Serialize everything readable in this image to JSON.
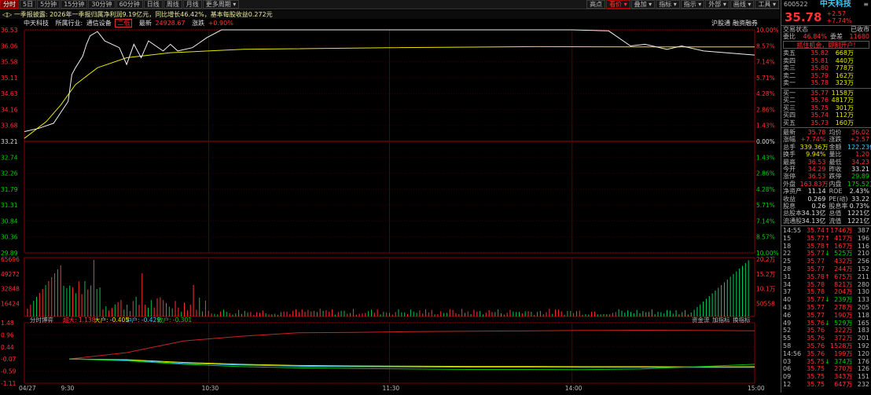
{
  "toolbar": {
    "left": [
      "分时",
      "5日",
      "5分钟",
      "15分钟",
      "30分钟",
      "60分钟",
      "日线",
      "周线",
      "月线",
      "更多周期"
    ],
    "right": [
      "高点",
      "看价",
      "叠加",
      "指标",
      "指示",
      "外部",
      "画线",
      "工具"
    ]
  },
  "info_bar": {
    "collapse": "◁▷",
    "text": "一季报披露: 2026年一季报归属净利润9.19亿元，同比增长46.42%，基本每股收益0.272元"
  },
  "stock_bar": {
    "name": "中天科技",
    "industry_label": "所属行业:",
    "industry": "通信设备",
    "tag": "二低",
    "latest_label": "最新",
    "latest": "24928.67",
    "change_label": "涨跌",
    "change": "+0.90%",
    "right1": "沪股通",
    "right2": "融资融券"
  },
  "chart_data": {
    "type": "line",
    "price_axis": [
      "36.53",
      "36.06",
      "35.58",
      "35.11",
      "34.63",
      "34.16",
      "33.68",
      "33.21",
      "32.74",
      "32.26",
      "31.79",
      "31.31",
      "30.84",
      "30.36",
      "29.89"
    ],
    "pct_axis": [
      "10.00%",
      "8.57%",
      "7.14%",
      "5.71%",
      "4.28%",
      "2.86%",
      "1.43%",
      "0.00%",
      "1.43%",
      "2.86%",
      "4.28%",
      "5.71%",
      "7.14%",
      "8.57%",
      "10.00%"
    ],
    "pre_close": 33.21,
    "ylim": [
      29.89,
      36.53
    ],
    "price_series": {
      "name": "价格",
      "t": [
        0,
        0.02,
        0.04,
        0.06,
        0.065,
        0.07,
        0.08,
        0.085,
        0.09,
        0.1,
        0.11,
        0.13,
        0.14,
        0.15,
        0.16,
        0.17,
        0.19,
        0.2,
        0.21,
        0.23,
        0.25,
        0.27,
        0.3,
        0.35,
        0.45,
        0.55,
        0.65,
        0.75,
        0.8,
        0.83,
        0.85,
        0.88,
        0.9,
        0.93,
        0.96,
        1.0
      ],
      "v": [
        33.5,
        33.6,
        33.75,
        34.4,
        35.2,
        35.4,
        35.75,
        36.1,
        36.35,
        36.48,
        36.2,
        36.0,
        35.5,
        36.1,
        35.7,
        36.2,
        35.9,
        36.1,
        35.9,
        36.0,
        36.3,
        36.53,
        36.53,
        36.53,
        36.53,
        36.53,
        36.53,
        36.53,
        36.5,
        36.05,
        36.1,
        35.95,
        36.05,
        35.9,
        35.85,
        35.78
      ]
    },
    "avg_series": {
      "name": "均价",
      "t": [
        0,
        0.03,
        0.05,
        0.07,
        0.1,
        0.14,
        0.2,
        0.3,
        0.5,
        0.7,
        0.85,
        1.0
      ],
      "v": [
        33.3,
        33.8,
        34.3,
        34.9,
        35.4,
        35.7,
        35.85,
        35.95,
        36.0,
        36.03,
        36.02,
        36.02
      ]
    },
    "volume_axis": [
      "65696",
      "49272",
      "32848",
      "16424"
    ],
    "volume_axis_right": [
      "20.2万",
      "15.2万",
      "10.1万",
      "50558"
    ],
    "indicator_title": "分时博弈",
    "indicator_legend": [
      "超大: 1.138",
      "大户: -0.405",
      "中户: -0.429",
      "散户: -0.301"
    ],
    "indicator_axis": [
      "1.48",
      "0.96",
      "0.44",
      "-0.07",
      "-0.59",
      "-1.11"
    ],
    "indicator_right": [
      "资金流",
      "加指标",
      "换指标"
    ],
    "time_axis": [
      "04/27",
      "9:30",
      "10:30",
      "11:30",
      "14:00",
      "15:00"
    ]
  },
  "panel": {
    "code": "600522",
    "name": "中天科技",
    "price": "35.78",
    "chg": "+2.57",
    "chg_pct": "+7.74%",
    "tabs": [
      "交易状态",
      "已收市"
    ],
    "ratio": {
      "k1": "委比",
      "v1": "46.84%",
      "k2": "委差",
      "v2": "11680"
    },
    "opportunity": "抓住机会，即刻开户!",
    "asks": [
      {
        "label": "卖五",
        "price": "35.82",
        "vol": "668万"
      },
      {
        "label": "卖四",
        "price": "35.81",
        "vol": "440万"
      },
      {
        "label": "卖三",
        "price": "35.80",
        "vol": "778万"
      },
      {
        "label": "卖二",
        "price": "35.79",
        "vol": "162万"
      },
      {
        "label": "卖一",
        "price": "35.78",
        "vol": "323万"
      }
    ],
    "bids": [
      {
        "label": "买一",
        "price": "35.77",
        "vol": "1158万"
      },
      {
        "label": "买二",
        "price": "35.76",
        "vol": "4817万"
      },
      {
        "label": "买三",
        "price": "35.75",
        "vol": "301万"
      },
      {
        "label": "买四",
        "price": "35.74",
        "vol": "112万"
      },
      {
        "label": "买五",
        "price": "35.73",
        "vol": "160万"
      }
    ],
    "stats": [
      {
        "k": "最新",
        "v": "35.78",
        "c": "red",
        "k2": "均价",
        "v2": "36.02",
        "c2": "red"
      },
      {
        "k": "涨幅",
        "v": "+7.74%",
        "c": "red",
        "k2": "涨跌",
        "v2": "+2.57",
        "c2": "red"
      },
      {
        "k": "总手",
        "v": "339.36万",
        "c": "yellow",
        "k2": "金额",
        "v2": "122.23亿",
        "c2": "cyan"
      },
      {
        "k": "换手",
        "v": "9.94%",
        "c": "yellow",
        "k2": "量比",
        "v2": "1.20",
        "c2": "red"
      },
      {
        "k": "最高",
        "v": "36.53",
        "c": "red",
        "k2": "最低",
        "v2": "34.23",
        "c2": "red"
      },
      {
        "k": "今开",
        "v": "34.29",
        "c": "red",
        "k2": "昨收",
        "v2": "33.21",
        "c2": "white"
      },
      {
        "k": "涨停",
        "v": "36.53",
        "c": "red",
        "k2": "跌停",
        "v2": "29.89",
        "c2": "green"
      },
      {
        "k": "外盘",
        "v": "163.83万",
        "c": "red",
        "k2": "内盘",
        "v2": "175.52万",
        "c2": "green"
      },
      {
        "k": "净资产",
        "v": "11.14",
        "c": "white",
        "k2": "ROE",
        "v2": "2.43%",
        "c2": "white"
      },
      {
        "k": "收益",
        "v": "0.269",
        "c": "white",
        "k2": "PE(动)",
        "v2": "33.22",
        "c2": "white"
      },
      {
        "k": "股息",
        "v": "0.26",
        "c": "white",
        "k2": "股息率",
        "v2": "0.73%",
        "c2": "white"
      },
      {
        "k": "总股本",
        "v": "34.13亿",
        "c": "white",
        "k2": "总值",
        "v2": "1221亿",
        "c2": "white"
      },
      {
        "k": "流通股",
        "v": "34.13亿",
        "c": "white",
        "k2": "流值",
        "v2": "1221亿",
        "c2": "white"
      }
    ],
    "ticks": [
      {
        "t": "14:55",
        "p": "35.74",
        "d": "up",
        "q": "1746万",
        "n": "387"
      },
      {
        "t": "15",
        "p": "35.77",
        "d": "up",
        "q": "417万",
        "n": "196"
      },
      {
        "t": "18",
        "p": "35.78",
        "d": "up",
        "q": "167万",
        "n": "116"
      },
      {
        "t": "22",
        "p": "35.77",
        "d": "down",
        "q": "525万",
        "n": "210"
      },
      {
        "t": "25",
        "p": "35.77",
        "d": "",
        "q": "432万",
        "n": "256"
      },
      {
        "t": "28",
        "p": "35.77",
        "d": "",
        "q": "244万",
        "n": "152"
      },
      {
        "t": "31",
        "p": "35.78",
        "d": "up",
        "q": "675万",
        "n": "211"
      },
      {
        "t": "34",
        "p": "35.78",
        "d": "",
        "q": "821万",
        "n": "280"
      },
      {
        "t": "37",
        "p": "35.78",
        "d": "",
        "q": "204万",
        "n": "130"
      },
      {
        "t": "40",
        "p": "35.77",
        "d": "down",
        "q": "239万",
        "n": "133"
      },
      {
        "t": "43",
        "p": "35.77",
        "d": "",
        "q": "278万",
        "n": "205"
      },
      {
        "t": "46",
        "p": "35.77",
        "d": "",
        "q": "190万",
        "n": "118"
      },
      {
        "t": "49",
        "p": "35.76",
        "d": "down",
        "q": "529万",
        "n": "165"
      },
      {
        "t": "52",
        "p": "35.76",
        "d": "",
        "q": "322万",
        "n": "183"
      },
      {
        "t": "55",
        "p": "35.76",
        "d": "",
        "q": "372万",
        "n": "201"
      },
      {
        "t": "58",
        "p": "35.76",
        "d": "",
        "q": "1528万",
        "n": "192"
      },
      {
        "t": "14:56",
        "p": "35.76",
        "d": "",
        "q": "199万",
        "n": "120"
      },
      {
        "t": "03",
        "p": "35.75",
        "d": "down",
        "q": "374万",
        "n": "176"
      },
      {
        "t": "06",
        "p": "35.75",
        "d": "",
        "q": "270万",
        "n": "126"
      },
      {
        "t": "09",
        "p": "35.75",
        "d": "",
        "q": "343万",
        "n": "151"
      },
      {
        "t": "12",
        "p": "35.75",
        "d": "",
        "q": "647万",
        "n": "232"
      }
    ]
  }
}
